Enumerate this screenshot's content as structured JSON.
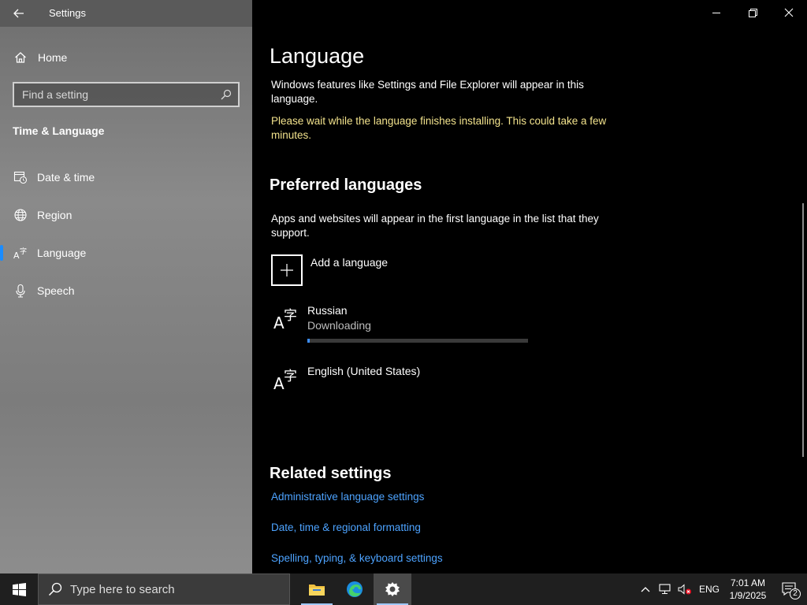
{
  "window": {
    "title": "Settings"
  },
  "sidebar": {
    "home_label": "Home",
    "search_placeholder": "Find a setting",
    "section_title": "Time & Language",
    "items": [
      {
        "label": "Date & time",
        "icon": "date-time-icon",
        "active": false
      },
      {
        "label": "Region",
        "icon": "globe-icon",
        "active": false
      },
      {
        "label": "Language",
        "icon": "language-icon",
        "active": true
      },
      {
        "label": "Speech",
        "icon": "microphone-icon",
        "active": false
      }
    ]
  },
  "main": {
    "title": "Language",
    "description": "Windows features like Settings and File Explorer will appear in this language.",
    "install_notice": "Please wait while the language finishes installing. This could take a few minutes.",
    "preferred": {
      "title": "Preferred languages",
      "description": "Apps and websites will appear in the first language in the list that they support.",
      "add_label": "Add a language",
      "languages": [
        {
          "name": "Russian",
          "status": "Downloading",
          "progress": 0.01
        },
        {
          "name": "English (United States)",
          "status": ""
        }
      ]
    },
    "related": {
      "title": "Related settings",
      "links": [
        "Administrative language settings",
        "Date, time & regional formatting",
        "Spelling, typing, & keyboard settings"
      ]
    }
  },
  "taskbar": {
    "search_placeholder": "Type here to search",
    "input_indicator": "ENG",
    "time": "7:01 AM",
    "date": "1/9/2025",
    "notification_count": "2"
  },
  "colors": {
    "accent": "#3c8eff",
    "link": "#4da3ff",
    "warning_text": "#f2e28c"
  }
}
